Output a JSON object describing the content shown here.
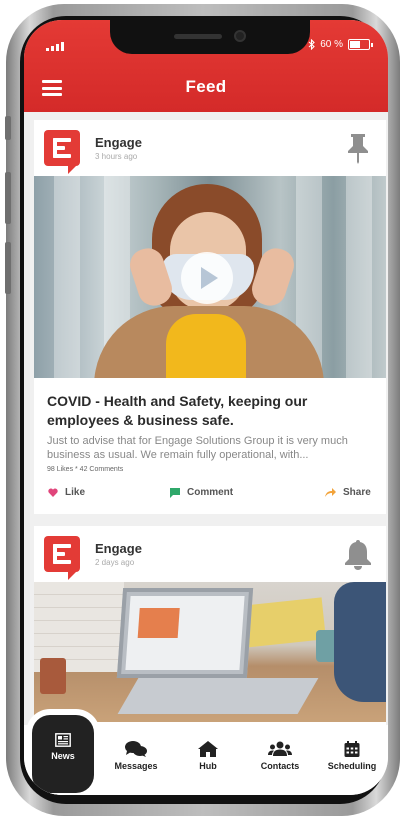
{
  "status_bar": {
    "battery_text": "60 %",
    "battery_level": 0.6
  },
  "header": {
    "title": "Feed",
    "menu_icon": "hamburger-menu-icon",
    "color": "#d42a29"
  },
  "posts": [
    {
      "author": "Engage",
      "time": "3 hours ago",
      "corner_icon": "pin-icon",
      "has_video": true,
      "title": "COVID - Health and Safety, keeping our employees & business safe.",
      "body": "Just to advise that for Engage Solutions Group it is very much business as usual. We remain fully operational, with...",
      "stats": "98 Likes * 42 Comments",
      "actions": {
        "like": "Like",
        "comment": "Comment",
        "share": "Share"
      }
    },
    {
      "author": "Engage",
      "time": "2 days ago",
      "corner_icon": "bell-icon"
    }
  ],
  "bottom_nav": {
    "active": "News",
    "items": [
      {
        "label": "News",
        "icon": "newspaper-icon"
      },
      {
        "label": "Messages",
        "icon": "chat-bubbles-icon"
      },
      {
        "label": "Hub",
        "icon": "home-icon"
      },
      {
        "label": "Contacts",
        "icon": "people-icon"
      },
      {
        "label": "Scheduling",
        "icon": "calendar-icon"
      }
    ]
  },
  "colors": {
    "brand_red": "#e33b36",
    "like_pink": "#e0457b",
    "comment_green": "#2fa86a",
    "share_orange": "#f2a33a",
    "nav_active_bg": "#222222"
  }
}
